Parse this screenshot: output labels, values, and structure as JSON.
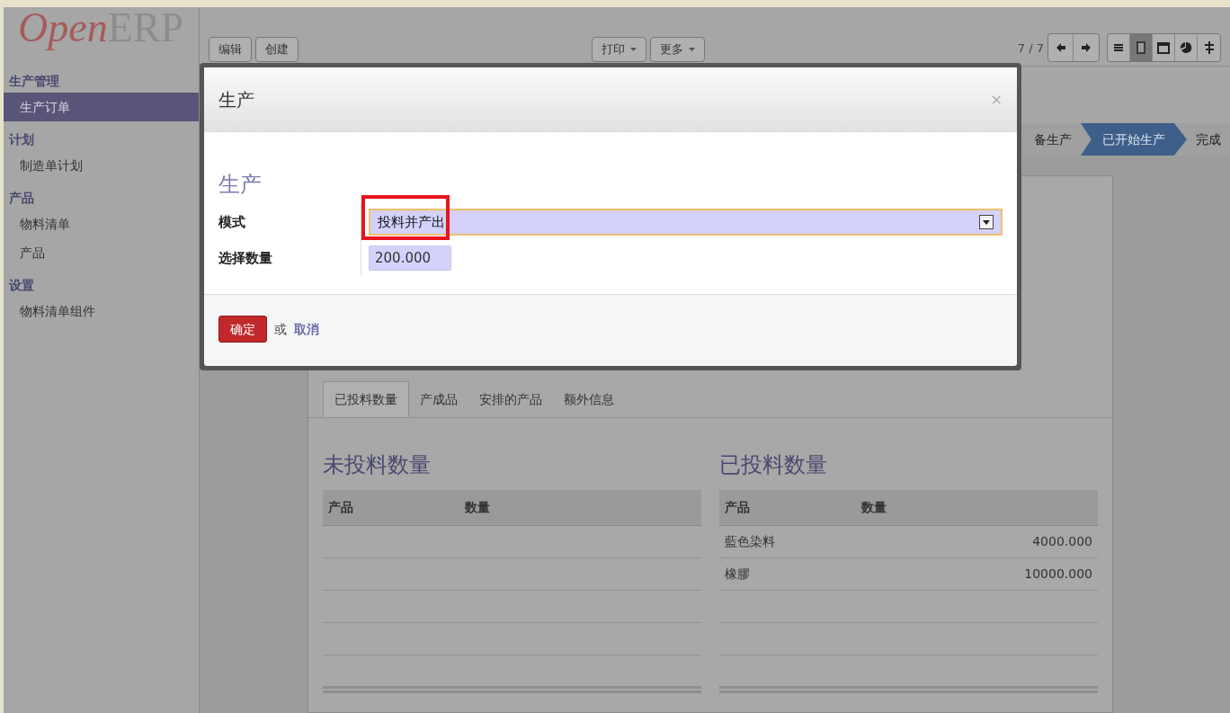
{
  "logo": {
    "part1": "Open",
    "part2": "ERP"
  },
  "sidebar": {
    "sections": [
      {
        "title": "生产管理",
        "items": [
          {
            "label": "生产订单",
            "selected": true
          }
        ]
      },
      {
        "title": "计划",
        "items": [
          {
            "label": "制造单计划",
            "selected": false
          }
        ]
      },
      {
        "title": "产品",
        "items": [
          {
            "label": "物料清单",
            "selected": false
          },
          {
            "label": "产品",
            "selected": false
          }
        ]
      },
      {
        "title": "设置",
        "items": [
          {
            "label": "物料清单组件",
            "selected": false
          }
        ]
      }
    ]
  },
  "toolbar": {
    "left_buttons": [
      "编辑",
      "创建"
    ],
    "menus": [
      "打印",
      "更多"
    ],
    "pager": "7 / 7",
    "views": [
      {
        "kind": "list",
        "selected": false
      },
      {
        "kind": "form",
        "selected": true
      },
      {
        "kind": "calendar",
        "selected": false
      },
      {
        "kind": "graph",
        "selected": false
      },
      {
        "kind": "gantt",
        "selected": false
      }
    ]
  },
  "status_steps": [
    {
      "label": "备生产",
      "selected": false
    },
    {
      "label": "已开始生产",
      "selected": true
    },
    {
      "label": "完成",
      "selected": false
    }
  ],
  "form": {
    "tabs": [
      {
        "label": "已投料数量",
        "selected": true
      },
      {
        "label": "产成品",
        "selected": false
      },
      {
        "label": "安排的产品",
        "selected": false
      },
      {
        "label": "额外信息",
        "selected": false
      }
    ],
    "tables": [
      {
        "title": "未投料数量",
        "columns": [
          "产品",
          "数量"
        ]
      },
      {
        "title": "已投料数量",
        "columns": [
          "产品",
          "数量"
        ],
        "rows": [
          {
            "product": "藍色染料",
            "qty": "4000.000"
          },
          {
            "product": "橡膠",
            "qty": "10000.000"
          }
        ]
      }
    ]
  },
  "dialog": {
    "title": "生产",
    "close": "×",
    "section": "生产",
    "fields": [
      {
        "kind": "select",
        "label": "模式",
        "value": "投料并产出",
        "highlighted": true
      },
      {
        "kind": "input",
        "label": "选择数量",
        "value": "200.000",
        "highlighted": false
      }
    ],
    "confirm": "确定",
    "or": "或",
    "cancel": "取消"
  }
}
